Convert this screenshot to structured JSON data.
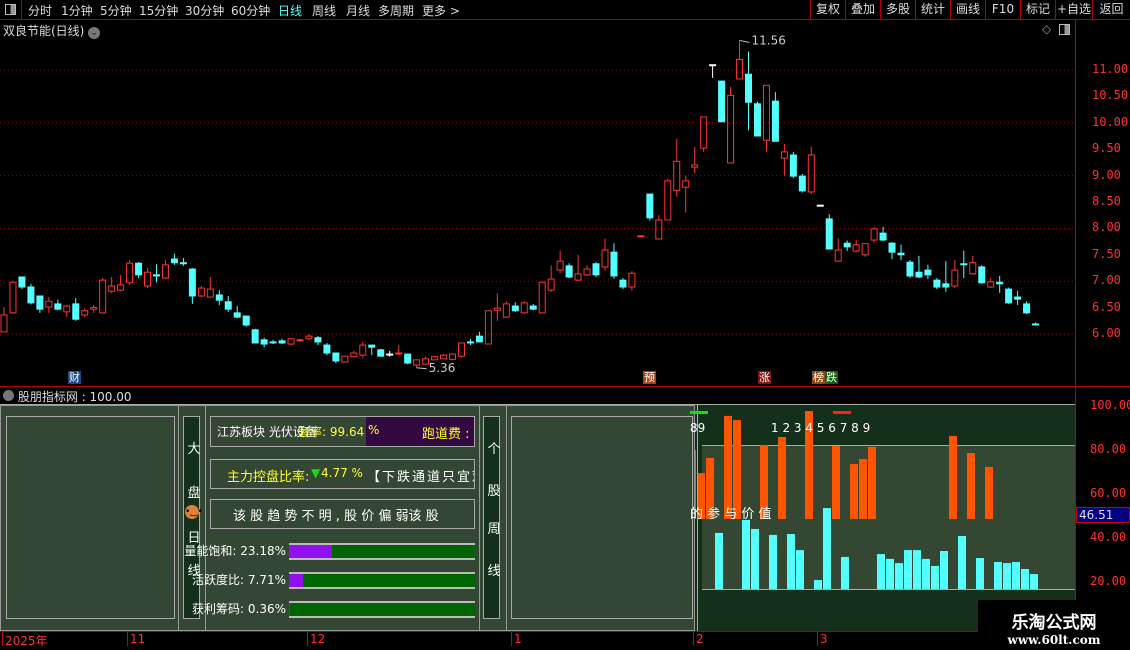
{
  "toolbar": {
    "periods": [
      "分时",
      "1分钟",
      "5分钟",
      "15分钟",
      "30分钟",
      "60分钟",
      "日线",
      "周线",
      "月线",
      "多周期",
      "更多 >"
    ],
    "active_period": "日线",
    "right_buttons": [
      "复权",
      "叠加",
      "多股",
      "统计",
      "画线",
      "F10",
      "标记",
      "+自选",
      "返回"
    ]
  },
  "chart": {
    "title": "双良节能(日线)",
    "price_ticks": [
      "11.00",
      "10.50",
      "10.00",
      "9.50",
      "9.00",
      "8.50",
      "8.00",
      "7.50",
      "7.00",
      "6.50",
      "6.00"
    ],
    "high_label": "11.56",
    "low_label": "5.36",
    "markers": [
      {
        "t": "财",
        "c": "#1a4a8a"
      },
      {
        "t": "预",
        "c": "#b04010"
      },
      {
        "t": "涨",
        "c": "#8a1010"
      },
      {
        "t": "榜",
        "c": "#8a4a10"
      },
      {
        "t": "跌",
        "c": "#106010"
      }
    ],
    "colors": {
      "up": "#ff3333",
      "down": "#54ffff",
      "grid": "#a00000"
    },
    "candles": [
      [
        6.04,
        6.51,
        6.04,
        6.36
      ],
      [
        6.4,
        7.0,
        6.38,
        6.98
      ],
      [
        7.08,
        7.08,
        6.85,
        6.89
      ],
      [
        6.89,
        6.95,
        6.56,
        6.59
      ],
      [
        6.72,
        6.72,
        6.4,
        6.47
      ],
      [
        6.51,
        6.7,
        6.4,
        6.62
      ],
      [
        6.57,
        6.65,
        6.45,
        6.47
      ],
      [
        6.42,
        6.55,
        6.32,
        6.53
      ],
      [
        6.57,
        6.68,
        6.25,
        6.28
      ],
      [
        6.36,
        6.49,
        6.32,
        6.44
      ],
      [
        6.47,
        6.55,
        6.4,
        6.5
      ],
      [
        6.4,
        7.06,
        6.38,
        7.02
      ],
      [
        6.81,
        7.08,
        6.77,
        6.91
      ],
      [
        6.83,
        7.12,
        6.81,
        6.93
      ],
      [
        6.97,
        7.4,
        6.93,
        7.34
      ],
      [
        7.34,
        7.36,
        7.06,
        7.12
      ],
      [
        6.91,
        7.25,
        6.87,
        7.17
      ],
      [
        7.12,
        7.32,
        6.98,
        7.1
      ],
      [
        7.06,
        7.4,
        7.04,
        7.31
      ],
      [
        7.42,
        7.52,
        7.31,
        7.35
      ],
      [
        7.35,
        7.44,
        7.29,
        7.33
      ],
      [
        7.23,
        7.25,
        6.57,
        6.72
      ],
      [
        6.72,
        6.91,
        6.7,
        6.87
      ],
      [
        6.7,
        7.08,
        6.7,
        6.85
      ],
      [
        6.74,
        6.83,
        6.55,
        6.64
      ],
      [
        6.61,
        6.72,
        6.42,
        6.47
      ],
      [
        6.4,
        6.53,
        6.3,
        6.32
      ],
      [
        6.34,
        6.34,
        6.14,
        6.17
      ],
      [
        6.08,
        6.1,
        5.83,
        5.83
      ],
      [
        5.89,
        5.93,
        5.75,
        5.81
      ],
      [
        5.85,
        5.89,
        5.81,
        5.85
      ],
      [
        5.87,
        5.91,
        5.81,
        5.83
      ],
      [
        5.81,
        5.93,
        5.79,
        5.91
      ],
      [
        5.88,
        5.91,
        5.85,
        5.89
      ],
      [
        5.91,
        6.0,
        5.89,
        5.96
      ],
      [
        5.93,
        5.96,
        5.79,
        5.85
      ],
      [
        5.79,
        5.83,
        5.6,
        5.64
      ],
      [
        5.64,
        5.64,
        5.45,
        5.49
      ],
      [
        5.47,
        5.58,
        5.47,
        5.58
      ],
      [
        5.57,
        5.68,
        5.57,
        5.64
      ],
      [
        5.6,
        5.85,
        5.55,
        5.79
      ],
      [
        5.79,
        5.79,
        5.6,
        5.75
      ],
      [
        5.7,
        5.72,
        5.58,
        5.58
      ],
      [
        5.62,
        5.68,
        5.57,
        5.62
      ],
      [
        5.62,
        5.79,
        5.6,
        5.64
      ],
      [
        5.62,
        5.62,
        5.43,
        5.45
      ],
      [
        5.41,
        5.51,
        5.36,
        5.51
      ],
      [
        5.43,
        5.57,
        5.43,
        5.53
      ],
      [
        5.51,
        5.59,
        5.51,
        5.57
      ],
      [
        5.53,
        5.62,
        5.53,
        5.6
      ],
      [
        5.52,
        5.62,
        5.5,
        5.62
      ],
      [
        5.58,
        5.83,
        5.55,
        5.83
      ],
      [
        5.85,
        5.91,
        5.79,
        5.85
      ],
      [
        5.96,
        6.04,
        5.85,
        5.85
      ],
      [
        5.81,
        6.44,
        5.81,
        6.44
      ],
      [
        6.45,
        6.77,
        6.25,
        6.49
      ],
      [
        6.32,
        6.62,
        6.3,
        6.57
      ],
      [
        6.53,
        6.6,
        6.42,
        6.44
      ],
      [
        6.4,
        6.62,
        6.38,
        6.59
      ],
      [
        6.53,
        6.57,
        6.45,
        6.47
      ],
      [
        6.4,
        7.0,
        6.4,
        6.98
      ],
      [
        6.83,
        7.3,
        6.8,
        7.04
      ],
      [
        7.21,
        7.58,
        7.15,
        7.38
      ],
      [
        7.29,
        7.34,
        7.06,
        7.08
      ],
      [
        7.02,
        7.5,
        7.0,
        7.14
      ],
      [
        7.12,
        7.3,
        7.1,
        7.23
      ],
      [
        7.33,
        7.36,
        7.08,
        7.12
      ],
      [
        7.27,
        7.81,
        7.2,
        7.59
      ],
      [
        7.55,
        7.72,
        7.05,
        7.1
      ],
      [
        7.02,
        7.06,
        6.85,
        6.89
      ],
      [
        6.89,
        7.19,
        6.82,
        7.15
      ],
      [
        7.86,
        7.86,
        7.86,
        7.86
      ],
      [
        8.65,
        8.65,
        8.15,
        8.2
      ],
      [
        7.8,
        8.25,
        7.8,
        8.16
      ],
      [
        8.16,
        8.94,
        8.16,
        8.9
      ],
      [
        8.72,
        9.7,
        8.6,
        9.27
      ],
      [
        8.78,
        9.0,
        8.3,
        8.9
      ],
      [
        9.16,
        9.55,
        9.05,
        9.2
      ],
      [
        9.52,
        10.11,
        9.45,
        10.11
      ],
      [
        11.1,
        11.1,
        10.85,
        11.1
      ],
      [
        10.79,
        10.79,
        10.02,
        10.02
      ],
      [
        9.24,
        10.68,
        9.24,
        10.52
      ],
      [
        10.83,
        11.56,
        10.83,
        11.2
      ],
      [
        10.92,
        11.35,
        9.86,
        10.39
      ],
      [
        10.36,
        10.4,
        9.75,
        9.75
      ],
      [
        9.67,
        10.71,
        9.45,
        10.71
      ],
      [
        10.41,
        10.58,
        9.65,
        9.65
      ],
      [
        9.33,
        9.6,
        9.0,
        9.45
      ],
      [
        9.39,
        9.45,
        8.95,
        8.99
      ],
      [
        8.99,
        9.03,
        8.68,
        8.71
      ],
      [
        8.69,
        9.55,
        8.65,
        9.39
      ],
      [
        8.44,
        8.44,
        8.44,
        8.44
      ],
      [
        8.18,
        8.27,
        7.61,
        7.61
      ],
      [
        7.38,
        7.81,
        7.38,
        7.59
      ],
      [
        7.72,
        7.77,
        7.57,
        7.65
      ],
      [
        7.57,
        7.78,
        7.54,
        7.69
      ],
      [
        7.5,
        7.71,
        7.46,
        7.71
      ],
      [
        7.78,
        8.03,
        7.73,
        7.99
      ],
      [
        7.91,
        8.03,
        7.76,
        7.78
      ],
      [
        7.72,
        7.74,
        7.42,
        7.55
      ],
      [
        7.53,
        7.69,
        7.4,
        7.5
      ],
      [
        7.36,
        7.4,
        7.06,
        7.1
      ],
      [
        7.17,
        7.48,
        7.06,
        7.08
      ],
      [
        7.21,
        7.31,
        7.04,
        7.12
      ],
      [
        7.02,
        7.06,
        6.85,
        6.89
      ],
      [
        6.95,
        7.38,
        6.8,
        6.89
      ],
      [
        6.91,
        7.4,
        6.87,
        7.21
      ],
      [
        7.33,
        7.58,
        7.06,
        7.33
      ],
      [
        7.14,
        7.48,
        7.12,
        7.35
      ],
      [
        7.27,
        7.3,
        6.95,
        6.97
      ],
      [
        6.89,
        7.06,
        6.87,
        6.99
      ],
      [
        6.98,
        7.1,
        6.78,
        6.95
      ],
      [
        6.85,
        6.88,
        6.57,
        6.59
      ],
      [
        6.7,
        6.82,
        6.55,
        6.66
      ],
      [
        6.57,
        6.62,
        6.38,
        6.4
      ],
      [
        6.19,
        6.22,
        6.16,
        6.19
      ]
    ]
  },
  "indicator": {
    "header": "股朋指标网 : 100.00",
    "ticks": [
      "100.00",
      "80.00",
      "60.00",
      "40.00",
      "20.00"
    ],
    "current_value": "46.51",
    "orange_bars": [
      [
        76,
        80
      ],
      [
        77,
        69.5
      ],
      [
        78,
        76.4
      ],
      [
        80,
        95.5
      ],
      [
        81,
        93.6
      ],
      [
        84,
        82.3
      ],
      [
        86,
        85.9
      ],
      [
        89,
        97.7
      ],
      [
        92,
        81.8
      ],
      [
        94,
        73.6
      ],
      [
        95,
        75.9
      ],
      [
        96,
        81.4
      ],
      [
        105,
        86.4
      ],
      [
        107,
        78.6
      ],
      [
        109,
        72.3
      ]
    ],
    "cyan_bars": [
      [
        79,
        42.3
      ],
      [
        82,
        48.2
      ],
      [
        83,
        44.1
      ],
      [
        85,
        41.4
      ],
      [
        87,
        41.8
      ],
      [
        88,
        34.5
      ],
      [
        90,
        20.9
      ],
      [
        91,
        53.6
      ],
      [
        93,
        31.4
      ],
      [
        97,
        32.7
      ],
      [
        98,
        30.5
      ],
      [
        99,
        28.6
      ],
      [
        100,
        34.5
      ],
      [
        101,
        34.5
      ],
      [
        102,
        30.5
      ],
      [
        103,
        27.3
      ],
      [
        104,
        34.1
      ],
      [
        106,
        40.9
      ],
      [
        108,
        30.9
      ],
      [
        110,
        29.1
      ],
      [
        111,
        28.6
      ],
      [
        112,
        29.1
      ],
      [
        113,
        25.9
      ],
      [
        114,
        23.6
      ]
    ],
    "colors": {
      "orange": "#ff5500",
      "cyan": "#54ffff"
    },
    "left_column": [
      "大",
      "盘",
      "日",
      "线"
    ],
    "right_column": [
      "个",
      "股",
      "周",
      "线"
    ],
    "sector": "江苏板块  光伏设备",
    "lock_rate": "套率: 99.64",
    "percent": "%",
    "runway_fee": "跑道费 :",
    "control_label": "主力控盘比率:",
    "control_value": "4.77 %",
    "control_note": "【下跌通道只宜观",
    "trend_text": "该 股 趋 势 不 明 , 股 价 偏 弱该 股",
    "volume_label": "量能饱和: 23.18%",
    "volume_pct": 23.18,
    "activity_label": "活跃度比: 7.71%",
    "activity_pct": 7.71,
    "profit_label": "获利筹码: 0.36%",
    "profit_pct": 0.36,
    "digits": "1 2 3 4 5 6 7 8 9",
    "digits_partial": "89",
    "value_text": "的  参  与  价  值"
  },
  "date_axis": [
    "2025年",
    "11",
    "12",
    "1",
    "2",
    "3"
  ],
  "watermark": {
    "name": "乐淘公式网",
    "url": "www.60lt.com"
  }
}
